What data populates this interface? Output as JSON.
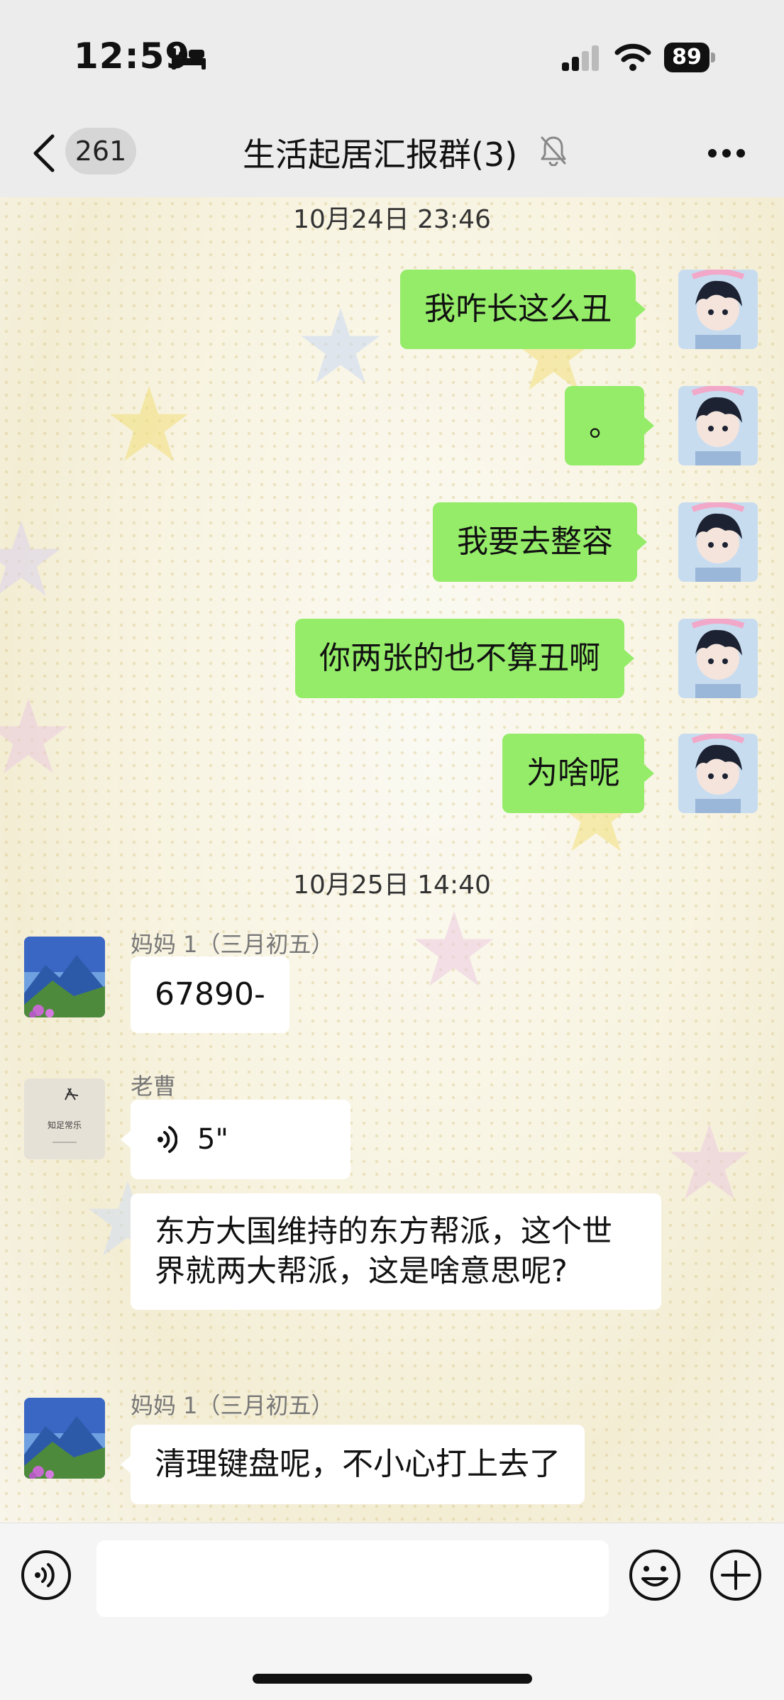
{
  "status_bar": {
    "time": "12:59",
    "battery": "89"
  },
  "header": {
    "unread_count": "261",
    "title": "生活起居汇报群(3)"
  },
  "chat": {
    "timestamp_1": "10月24日 23:46",
    "sent_messages": [
      "我咋长这么丑",
      "。",
      "我要去整容",
      "你两张的也不算丑啊",
      "为啥呢"
    ],
    "timestamp_2": "10月25日 14:40",
    "group_1": {
      "sender": "妈妈 1（三月初五）",
      "message": "67890-"
    },
    "group_2": {
      "sender": "老曹",
      "voice_duration": "5\"",
      "message": "东方大国维持的东方帮派，这个世界就两大帮派，这是啥意思呢?"
    },
    "group_3": {
      "sender": "妈妈 1（三月初五）",
      "message": "清理键盘呢，不小心打上去了"
    },
    "laocao_avatar_text": "知足常乐"
  },
  "input_bar": {
    "placeholder": ""
  },
  "colors": {
    "sent_bubble": "#95ec69",
    "recv_bubble": "#ffffff",
    "background": "#f6f2e4"
  }
}
